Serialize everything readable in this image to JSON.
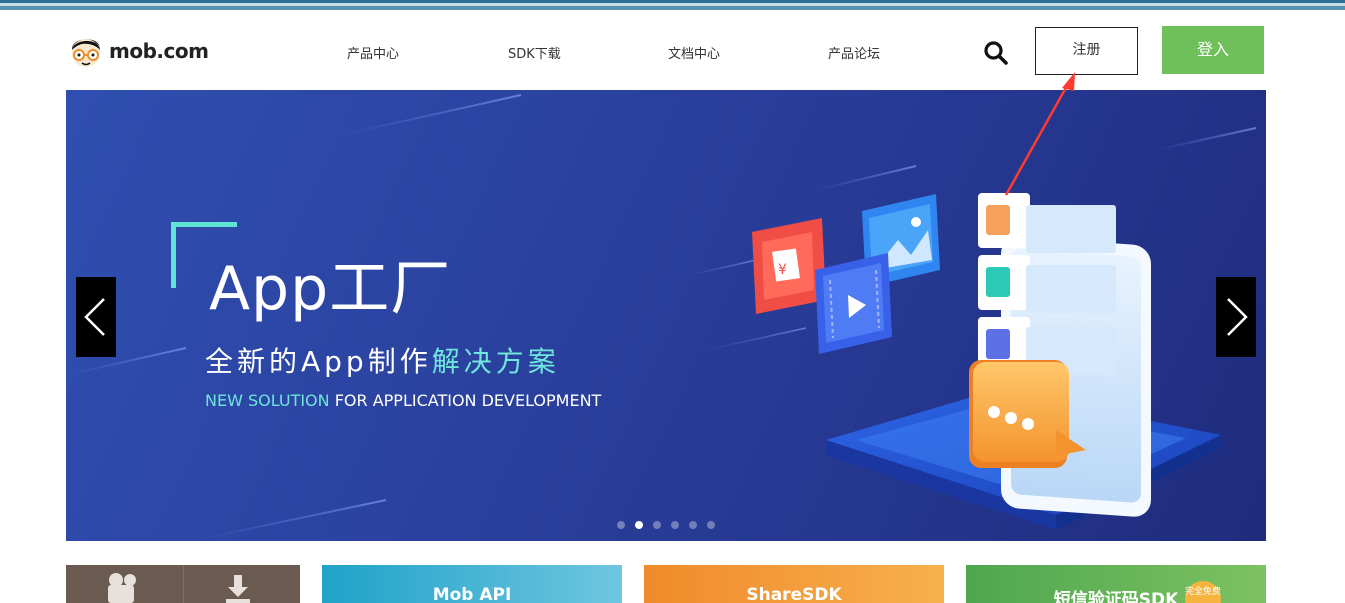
{
  "header": {
    "logo_text": "mob.com",
    "nav": [
      {
        "label": "产品中心"
      },
      {
        "label": "SDK下载"
      },
      {
        "label": "文档中心"
      },
      {
        "label": "产品论坛"
      }
    ],
    "register_label": "注册",
    "login_label": "登入"
  },
  "banner": {
    "title": "App工厂",
    "subtitle_main": "全新的App制作",
    "subtitle_highlight": "解决方案",
    "english_highlight": "NEW SOLUTION",
    "english_rest": " FOR APPLICATION DEVELOPMENT",
    "slide_count": 6,
    "active_slide": 2
  },
  "cards": [
    {
      "label": ""
    },
    {
      "label": "Mob API"
    },
    {
      "label": "ShareSDK"
    },
    {
      "label": "短信验证码SDK",
      "badge": "完全免费"
    }
  ],
  "colors": {
    "login_green": "#6fc05b",
    "banner_blue": "#2a3f9c",
    "accent_teal": "#6ee6dc",
    "annotation_red": "#ff3b30"
  }
}
